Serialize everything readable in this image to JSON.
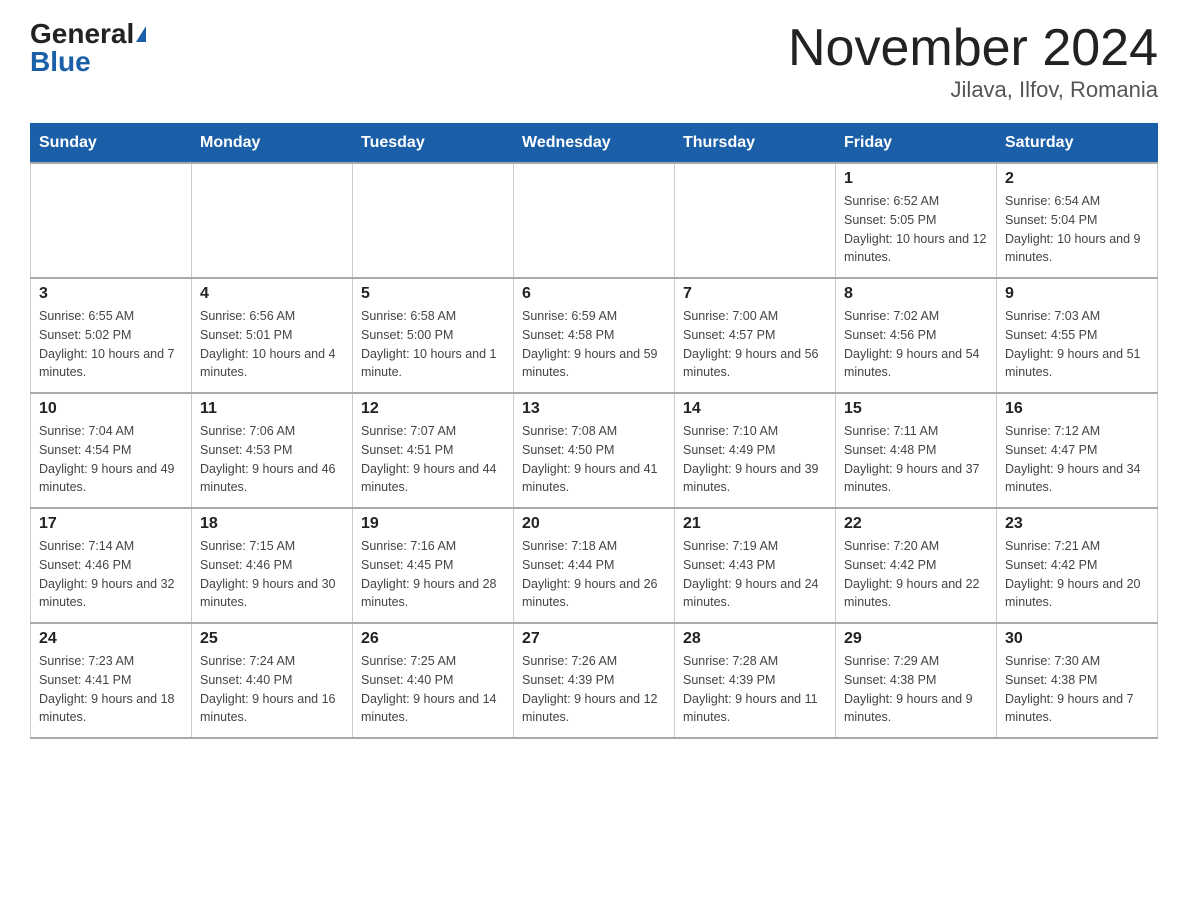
{
  "header": {
    "logo_general": "General",
    "logo_blue": "Blue",
    "title": "November 2024",
    "subtitle": "Jilava, Ilfov, Romania"
  },
  "days_of_week": [
    "Sunday",
    "Monday",
    "Tuesday",
    "Wednesday",
    "Thursday",
    "Friday",
    "Saturday"
  ],
  "weeks": [
    [
      {
        "day": "",
        "info": ""
      },
      {
        "day": "",
        "info": ""
      },
      {
        "day": "",
        "info": ""
      },
      {
        "day": "",
        "info": ""
      },
      {
        "day": "",
        "info": ""
      },
      {
        "day": "1",
        "info": "Sunrise: 6:52 AM\nSunset: 5:05 PM\nDaylight: 10 hours and 12 minutes."
      },
      {
        "day": "2",
        "info": "Sunrise: 6:54 AM\nSunset: 5:04 PM\nDaylight: 10 hours and 9 minutes."
      }
    ],
    [
      {
        "day": "3",
        "info": "Sunrise: 6:55 AM\nSunset: 5:02 PM\nDaylight: 10 hours and 7 minutes."
      },
      {
        "day": "4",
        "info": "Sunrise: 6:56 AM\nSunset: 5:01 PM\nDaylight: 10 hours and 4 minutes."
      },
      {
        "day": "5",
        "info": "Sunrise: 6:58 AM\nSunset: 5:00 PM\nDaylight: 10 hours and 1 minute."
      },
      {
        "day": "6",
        "info": "Sunrise: 6:59 AM\nSunset: 4:58 PM\nDaylight: 9 hours and 59 minutes."
      },
      {
        "day": "7",
        "info": "Sunrise: 7:00 AM\nSunset: 4:57 PM\nDaylight: 9 hours and 56 minutes."
      },
      {
        "day": "8",
        "info": "Sunrise: 7:02 AM\nSunset: 4:56 PM\nDaylight: 9 hours and 54 minutes."
      },
      {
        "day": "9",
        "info": "Sunrise: 7:03 AM\nSunset: 4:55 PM\nDaylight: 9 hours and 51 minutes."
      }
    ],
    [
      {
        "day": "10",
        "info": "Sunrise: 7:04 AM\nSunset: 4:54 PM\nDaylight: 9 hours and 49 minutes."
      },
      {
        "day": "11",
        "info": "Sunrise: 7:06 AM\nSunset: 4:53 PM\nDaylight: 9 hours and 46 minutes."
      },
      {
        "day": "12",
        "info": "Sunrise: 7:07 AM\nSunset: 4:51 PM\nDaylight: 9 hours and 44 minutes."
      },
      {
        "day": "13",
        "info": "Sunrise: 7:08 AM\nSunset: 4:50 PM\nDaylight: 9 hours and 41 minutes."
      },
      {
        "day": "14",
        "info": "Sunrise: 7:10 AM\nSunset: 4:49 PM\nDaylight: 9 hours and 39 minutes."
      },
      {
        "day": "15",
        "info": "Sunrise: 7:11 AM\nSunset: 4:48 PM\nDaylight: 9 hours and 37 minutes."
      },
      {
        "day": "16",
        "info": "Sunrise: 7:12 AM\nSunset: 4:47 PM\nDaylight: 9 hours and 34 minutes."
      }
    ],
    [
      {
        "day": "17",
        "info": "Sunrise: 7:14 AM\nSunset: 4:46 PM\nDaylight: 9 hours and 32 minutes."
      },
      {
        "day": "18",
        "info": "Sunrise: 7:15 AM\nSunset: 4:46 PM\nDaylight: 9 hours and 30 minutes."
      },
      {
        "day": "19",
        "info": "Sunrise: 7:16 AM\nSunset: 4:45 PM\nDaylight: 9 hours and 28 minutes."
      },
      {
        "day": "20",
        "info": "Sunrise: 7:18 AM\nSunset: 4:44 PM\nDaylight: 9 hours and 26 minutes."
      },
      {
        "day": "21",
        "info": "Sunrise: 7:19 AM\nSunset: 4:43 PM\nDaylight: 9 hours and 24 minutes."
      },
      {
        "day": "22",
        "info": "Sunrise: 7:20 AM\nSunset: 4:42 PM\nDaylight: 9 hours and 22 minutes."
      },
      {
        "day": "23",
        "info": "Sunrise: 7:21 AM\nSunset: 4:42 PM\nDaylight: 9 hours and 20 minutes."
      }
    ],
    [
      {
        "day": "24",
        "info": "Sunrise: 7:23 AM\nSunset: 4:41 PM\nDaylight: 9 hours and 18 minutes."
      },
      {
        "day": "25",
        "info": "Sunrise: 7:24 AM\nSunset: 4:40 PM\nDaylight: 9 hours and 16 minutes."
      },
      {
        "day": "26",
        "info": "Sunrise: 7:25 AM\nSunset: 4:40 PM\nDaylight: 9 hours and 14 minutes."
      },
      {
        "day": "27",
        "info": "Sunrise: 7:26 AM\nSunset: 4:39 PM\nDaylight: 9 hours and 12 minutes."
      },
      {
        "day": "28",
        "info": "Sunrise: 7:28 AM\nSunset: 4:39 PM\nDaylight: 9 hours and 11 minutes."
      },
      {
        "day": "29",
        "info": "Sunrise: 7:29 AM\nSunset: 4:38 PM\nDaylight: 9 hours and 9 minutes."
      },
      {
        "day": "30",
        "info": "Sunrise: 7:30 AM\nSunset: 4:38 PM\nDaylight: 9 hours and 7 minutes."
      }
    ]
  ]
}
